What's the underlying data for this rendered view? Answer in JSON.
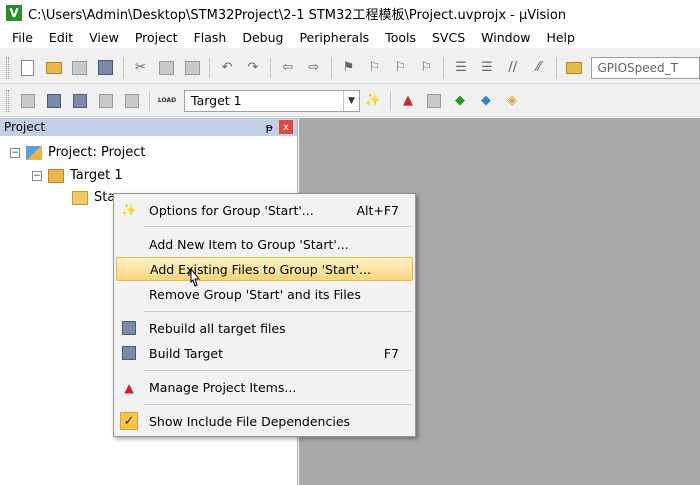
{
  "window": {
    "title": "C:\\Users\\Admin\\Desktop\\STM32Project\\2-1 STM32工程模板\\Project.uvprojx - µVision",
    "logo_letter": "V"
  },
  "menu": [
    "File",
    "Edit",
    "View",
    "Project",
    "Flash",
    "Debug",
    "Peripherals",
    "Tools",
    "SVCS",
    "Window",
    "Help"
  ],
  "toolbar": {
    "speed_box_text": "GPIOSpeed_T",
    "target_select": "Target 1",
    "load_icon_text": "LOAD"
  },
  "project_panel": {
    "title": "Project",
    "pin_glyph": "ᵽ",
    "close_glyph": "x",
    "tree": {
      "root": "Project: Project",
      "target": "Target 1",
      "group": "Sta"
    }
  },
  "context_menu": {
    "items": [
      {
        "label": "Options for Group 'Start'...",
        "shortcut": "Alt+F7"
      },
      {
        "label": "Add New  Item to Group 'Start'..."
      },
      {
        "label": "Add Existing Files to Group 'Start'..."
      },
      {
        "label": "Remove Group 'Start' and its Files"
      },
      {
        "label": "Rebuild all target files"
      },
      {
        "label": "Build Target",
        "shortcut": "F7"
      },
      {
        "label": "Manage Project Items..."
      },
      {
        "label": "Show Include File Dependencies",
        "checked": true
      }
    ]
  },
  "colors": {
    "panel_header": "#c3cfe6",
    "workspace": "#a9a9a9",
    "highlight": "#f8d57a"
  }
}
